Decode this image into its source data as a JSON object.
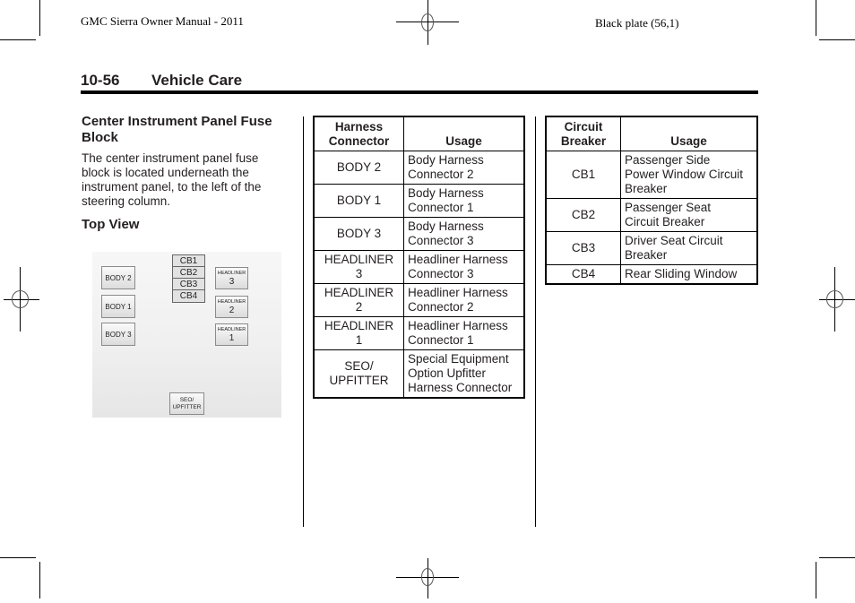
{
  "print_header": {
    "left": "GMC Sierra Owner Manual - 2011",
    "right": "Black plate (56,1)"
  },
  "page_header": {
    "page_number": "10-56",
    "section": "Vehicle Care"
  },
  "left_column": {
    "heading": "Center Instrument Panel Fuse Block",
    "body": "The center instrument panel fuse block is located underneath the instrument panel, to the left of the steering column.",
    "subheading": "Top View",
    "diagram": {
      "left_fuses": [
        "BODY 2",
        "BODY 1",
        "BODY 3"
      ],
      "circuit_breakers": [
        "CB1",
        "CB2",
        "CB3",
        "CB4"
      ],
      "headliners": [
        {
          "label": "HEADLINER",
          "num": "3"
        },
        {
          "label": "HEADLINER",
          "num": "2"
        },
        {
          "label": "HEADLINER",
          "num": "1"
        }
      ],
      "bottom_connector": {
        "line1": "SEO/",
        "line2": "UPFITTER"
      }
    }
  },
  "harness_table": {
    "headers": [
      "Harness\nConnector",
      "Usage"
    ],
    "rows": [
      [
        "BODY 2",
        "Body Harness\nConnector 2"
      ],
      [
        "BODY 1",
        "Body Harness\nConnector 1"
      ],
      [
        "BODY 3",
        "Body Harness\nConnector 3"
      ],
      [
        "HEADLINER\n3",
        "Headliner Harness\nConnector 3"
      ],
      [
        "HEADLINER\n2",
        "Headliner Harness\nConnector 2"
      ],
      [
        "HEADLINER\n1",
        "Headliner Harness\nConnector 1"
      ],
      [
        "SEO/\nUPFITTER",
        "Special Equipment\nOption Upfitter\nHarness Connector"
      ]
    ]
  },
  "breaker_table": {
    "headers": [
      "Circuit\nBreaker",
      "Usage"
    ],
    "rows": [
      [
        "CB1",
        "Passenger Side\nPower Window Circuit\nBreaker"
      ],
      [
        "CB2",
        "Passenger Seat\nCircuit Breaker"
      ],
      [
        "CB3",
        "Driver Seat Circuit\nBreaker"
      ],
      [
        "CB4",
        "Rear Sliding Window"
      ]
    ]
  }
}
